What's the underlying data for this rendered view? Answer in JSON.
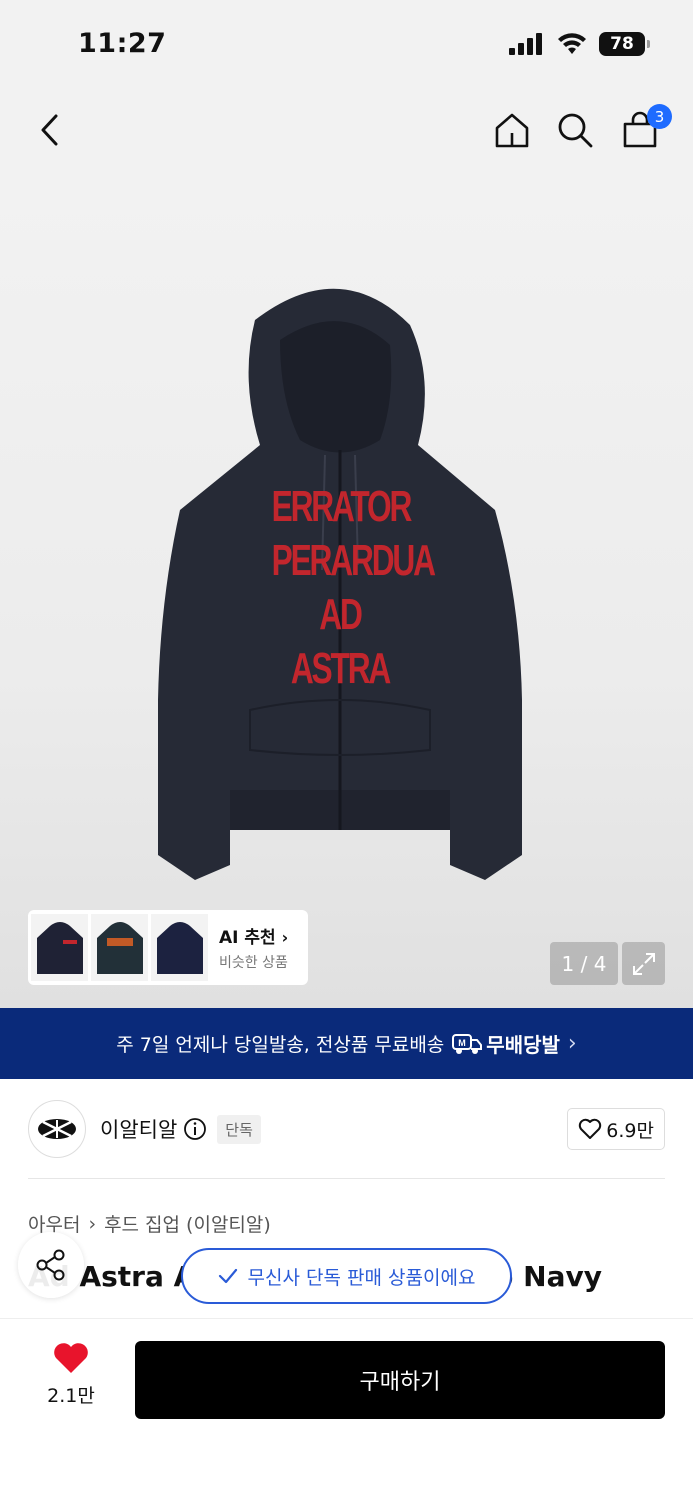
{
  "status": {
    "time": "11:27",
    "battery": "78"
  },
  "nav": {
    "cart_count": "3"
  },
  "hero": {
    "print_lines": [
      "ERRATOR",
      "PERARDUA",
      "AD ASTRA"
    ],
    "pager": "1 / 4",
    "ai_title": "AI 추천",
    "ai_subtitle": "비슷한 상품"
  },
  "promo": {
    "text": "주 7일 언제나 당일발송, 전상품 무료배송",
    "badge": "무배당발"
  },
  "brand": {
    "name": "이알티알",
    "tag": "단독",
    "likes": "6.9만"
  },
  "breadcrumb": {
    "category": "아우터",
    "subcategory": "후드 집업 (이알티알)"
  },
  "product": {
    "title": "Ad Astra Ad Astra Hood Zip Up Navy"
  },
  "toast": {
    "text": "무신사 단독 판매 상품이에요"
  },
  "bottom": {
    "heart_count": "2.1만",
    "buy_label": "구매하기"
  },
  "colors": {
    "promo_bg": "#0a2a7a",
    "badge": "#1e6bff",
    "heart": "#e8142c",
    "toast": "#2a5bd7"
  }
}
